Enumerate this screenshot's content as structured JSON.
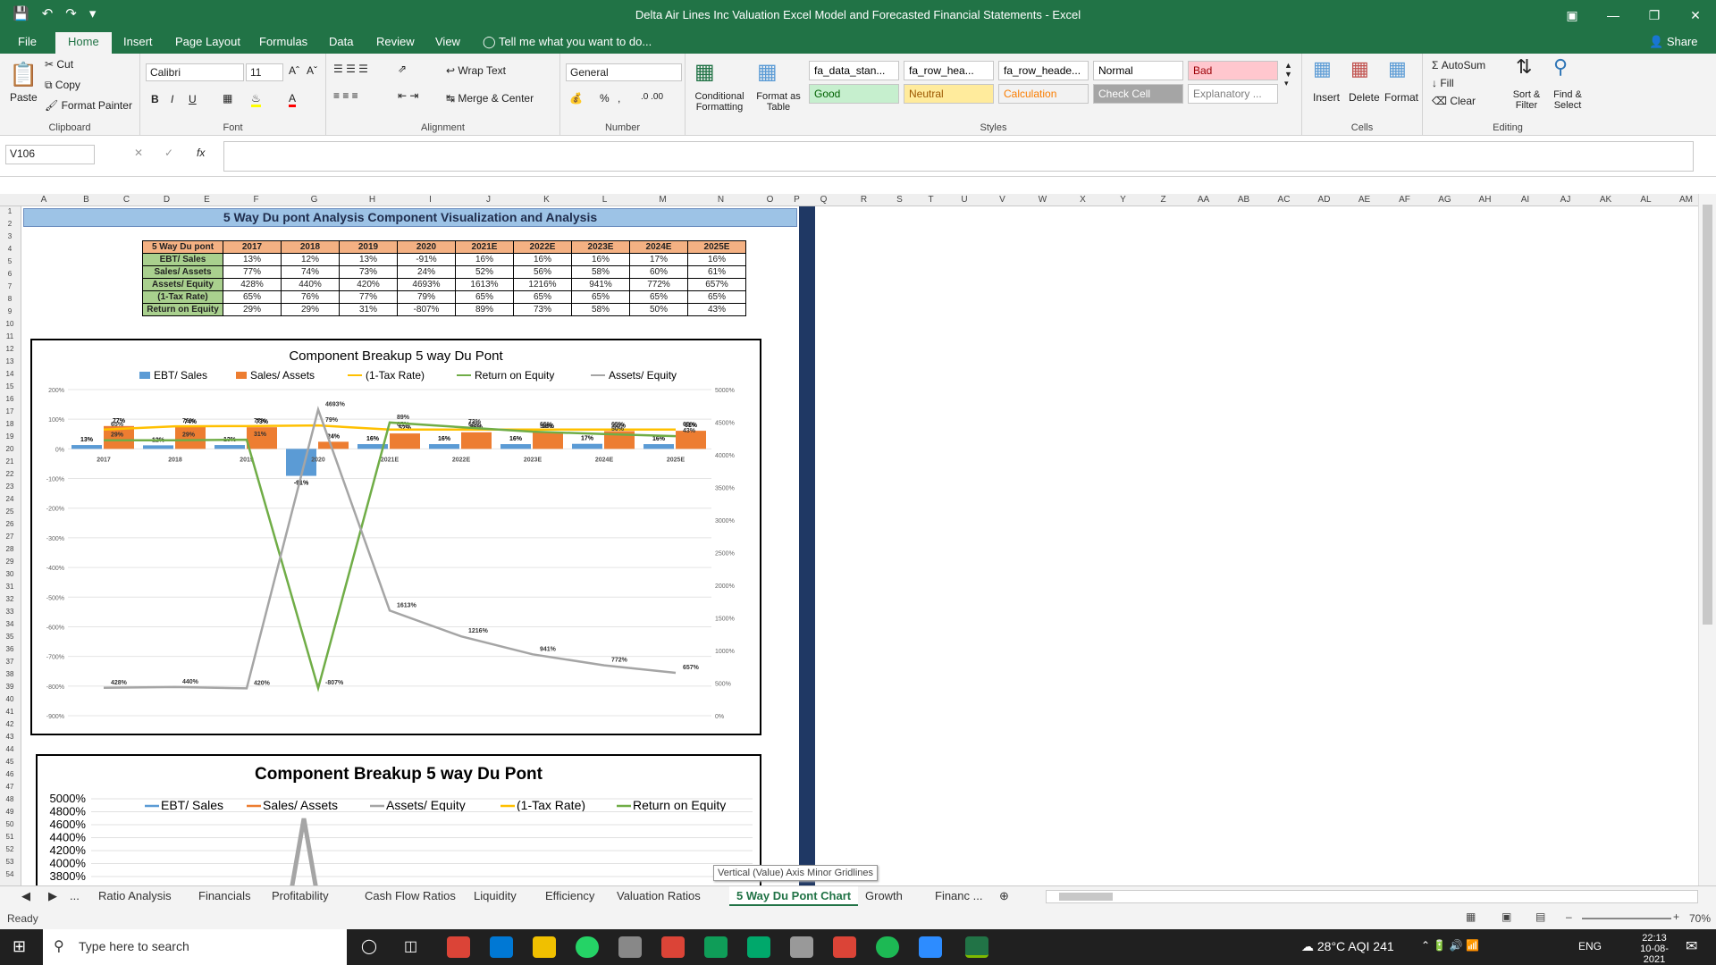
{
  "window": {
    "title": "Delta Air Lines Inc Valuation Excel Model and Forecasted Financial Statements - Excel",
    "share": "Share"
  },
  "tabs": [
    "File",
    "Home",
    "Insert",
    "Page Layout",
    "Formulas",
    "Data",
    "Review",
    "View"
  ],
  "tell_me": "Tell me what you want to do...",
  "ribbon": {
    "clipboard": {
      "paste": "Paste",
      "cut": "Cut",
      "copy": "Copy",
      "format_painter": "Format Painter",
      "label": "Clipboard"
    },
    "font": {
      "name": "Calibri",
      "size": "11",
      "label": "Font"
    },
    "alignment": {
      "wrap": "Wrap Text",
      "merge": "Merge & Center",
      "label": "Alignment"
    },
    "number": {
      "format": "General",
      "label": "Number"
    },
    "styles": {
      "conditional": "Conditional Formatting",
      "format_table": "Format as Table",
      "label": "Styles",
      "cells": [
        {
          "text": "fa_data_stan...",
          "bg": "#ffffff",
          "fg": "#000000"
        },
        {
          "text": "fa_row_hea...",
          "bg": "#ffffff",
          "fg": "#000000"
        },
        {
          "text": "fa_row_heade...",
          "bg": "#ffffff",
          "fg": "#000000"
        },
        {
          "text": "Normal",
          "bg": "#ffffff",
          "fg": "#000000"
        },
        {
          "text": "Bad",
          "bg": "#ffc7ce",
          "fg": "#9c0006"
        },
        {
          "text": "Good",
          "bg": "#c6efce",
          "fg": "#006100"
        },
        {
          "text": "Neutral",
          "bg": "#ffeb9c",
          "fg": "#9c5700"
        },
        {
          "text": "Calculation",
          "bg": "#f2f2f2",
          "fg": "#fa7d00"
        },
        {
          "text": "Check Cell",
          "bg": "#a5a5a5",
          "fg": "#ffffff"
        },
        {
          "text": "Explanatory ...",
          "bg": "#ffffff",
          "fg": "#7f7f7f"
        }
      ]
    },
    "cells": {
      "insert": "Insert",
      "delete": "Delete",
      "format": "Format",
      "label": "Cells"
    },
    "editing": {
      "autosum": "AutoSum",
      "fill": "Fill",
      "clear": "Clear",
      "sort": "Sort & Filter",
      "find": "Find & Select",
      "label": "Editing"
    }
  },
  "namebox": "V106",
  "columns": [
    "A",
    "B",
    "C",
    "D",
    "E",
    "F",
    "G",
    "H",
    "I",
    "J",
    "K",
    "L",
    "M",
    "N",
    "O",
    "P",
    "Q",
    "R",
    "S",
    "T",
    "U",
    "V",
    "W",
    "X",
    "Y",
    "Z",
    "AA",
    "AB",
    "AC",
    "AD",
    "AE",
    "AF",
    "AG",
    "AH",
    "AI",
    "AJ",
    "AK",
    "AL",
    "AM"
  ],
  "sheet": {
    "banner": "5 Way Du pont Analysis Component Visualization and Analysis",
    "table": {
      "header": [
        "5 Way Du pont",
        "2017",
        "2018",
        "2019",
        "2020",
        "2021E",
        "2022E",
        "2023E",
        "2024E",
        "2025E"
      ],
      "rows": [
        [
          "EBT/ Sales",
          "13%",
          "12%",
          "13%",
          "-91%",
          "16%",
          "16%",
          "16%",
          "17%",
          "16%"
        ],
        [
          "Sales/ Assets",
          "77%",
          "74%",
          "73%",
          "24%",
          "52%",
          "56%",
          "58%",
          "60%",
          "61%"
        ],
        [
          "Assets/ Equity",
          "428%",
          "440%",
          "420%",
          "4693%",
          "1613%",
          "1216%",
          "941%",
          "772%",
          "657%"
        ],
        [
          "(1-Tax Rate)",
          "65%",
          "76%",
          "77%",
          "79%",
          "65%",
          "65%",
          "65%",
          "65%",
          "65%"
        ],
        [
          "Return on Equity",
          "29%",
          "29%",
          "31%",
          "-807%",
          "89%",
          "73%",
          "58%",
          "50%",
          "43%"
        ]
      ]
    }
  },
  "chart_data": [
    {
      "type": "bar",
      "title": "Component Breakup 5 way Du Pont",
      "categories": [
        "2017",
        "2018",
        "2019",
        "2020",
        "2021E",
        "2022E",
        "2023E",
        "2024E",
        "2025E"
      ],
      "series": [
        {
          "name": "EBT/ Sales",
          "kind": "bar",
          "axis": "left",
          "color": "#5b9bd5",
          "values": [
            13,
            12,
            13,
            -91,
            16,
            16,
            16,
            17,
            16
          ]
        },
        {
          "name": "Sales/ Assets",
          "kind": "bar",
          "axis": "left",
          "color": "#ed7d31",
          "values": [
            77,
            74,
            73,
            24,
            52,
            56,
            58,
            60,
            61
          ]
        },
        {
          "name": "(1-Tax Rate)",
          "kind": "line",
          "axis": "left",
          "color": "#ffc000",
          "values": [
            65,
            76,
            77,
            79,
            65,
            65,
            65,
            65,
            65
          ]
        },
        {
          "name": "Return on Equity",
          "kind": "line",
          "axis": "left",
          "color": "#70ad47",
          "values": [
            29,
            29,
            31,
            -807,
            89,
            73,
            58,
            50,
            43
          ]
        },
        {
          "name": "Assets/ Equity",
          "kind": "line",
          "axis": "right",
          "color": "#a5a5a5",
          "values": [
            428,
            440,
            420,
            4693,
            1613,
            1216,
            941,
            772,
            657
          ]
        }
      ],
      "ylim_left": [
        -900,
        200
      ],
      "ylim_right": [
        0,
        5000
      ],
      "left_ticks": [
        "200%",
        "100%",
        "0%",
        "-100%",
        "-200%",
        "-300%",
        "-400%",
        "-500%",
        "-600%",
        "-700%",
        "-800%",
        "-900%"
      ],
      "right_ticks": [
        "5000%",
        "4500%",
        "4000%",
        "3500%",
        "3000%",
        "2500%",
        "2000%",
        "1500%",
        "1000%",
        "500%",
        "0%"
      ],
      "legend": "top"
    },
    {
      "type": "line",
      "title": "Component Breakup 5 way Du Pont",
      "legend_items": [
        {
          "name": "EBT/ Sales",
          "color": "#5b9bd5"
        },
        {
          "name": "Sales/ Assets",
          "color": "#ed7d31"
        },
        {
          "name": "Assets/ Equity",
          "color": "#a5a5a5"
        },
        {
          "name": "(1-Tax Rate)",
          "color": "#ffc000"
        },
        {
          "name": "Return on Equity",
          "color": "#70ad47"
        }
      ],
      "y_ticks": [
        "5000%",
        "4800%",
        "4600%",
        "4400%",
        "4200%",
        "4000%",
        "3800%"
      ]
    }
  ],
  "tooltip": "Vertical (Value) Axis Minor Gridlines",
  "sheet_tabs": [
    "...",
    "Ratio Analysis",
    "Financials",
    "Profitability",
    "Cash Flow Ratios",
    "Liquidity",
    "Efficiency",
    "Valuation Ratios",
    "5 Way Du Pont Chart",
    "Growth",
    "Financ ..."
  ],
  "active_sheet": "5 Way Du Pont Chart",
  "status": {
    "ready": "Ready",
    "zoom": "70%"
  },
  "taskbar": {
    "search": "Type here to search",
    "weather": "28°C  AQI 241",
    "lang": "ENG",
    "time": "22:13",
    "date": "10-08-2021"
  }
}
